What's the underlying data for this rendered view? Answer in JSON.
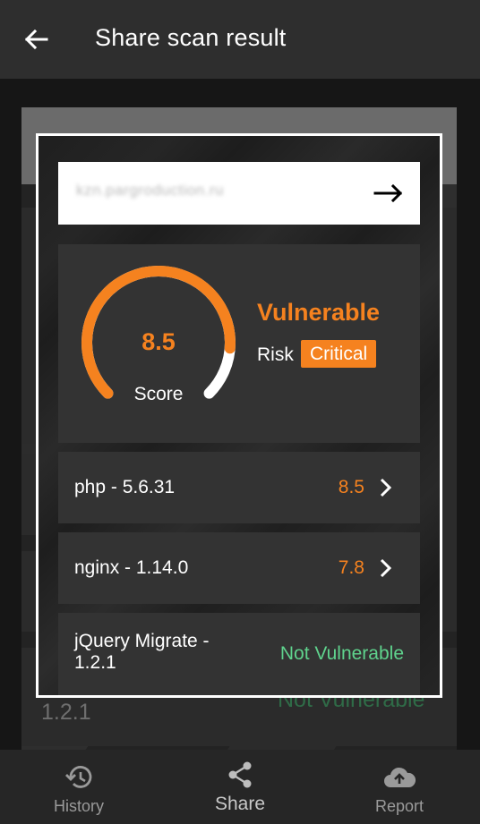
{
  "appbar": {
    "title": "Share scan result",
    "back_icon": "arrow-left-icon"
  },
  "background_ghost": {
    "version_text": "1.2.1",
    "status_text": "Not Vulnerable"
  },
  "preview": {
    "url": "kzn.pargroduction.ru",
    "url_go_icon": "arrow-right-icon",
    "score": {
      "value": "8.5",
      "gauge_fraction": 0.85,
      "label": "Score",
      "status": "Vulnerable",
      "risk_label": "Risk",
      "risk_level": "Critical"
    },
    "items": [
      {
        "name": "php - 5.6.31",
        "score": "8.5"
      },
      {
        "name": "nginx - 1.14.0",
        "score": "7.8"
      },
      {
        "name": "jQuery Migrate - 1.2.1",
        "status": "Not Vulnerable"
      }
    ]
  },
  "bottom_nav": {
    "history": {
      "label": "History",
      "icon": "history-icon"
    },
    "share": {
      "label": "Share",
      "icon": "share-icon"
    },
    "report": {
      "label": "Report",
      "icon": "cloud-upload-icon"
    }
  },
  "colors": {
    "accent": "#f5821f",
    "safe": "#5fd38d",
    "card": "#333333",
    "appbar": "#2e2e2e"
  }
}
